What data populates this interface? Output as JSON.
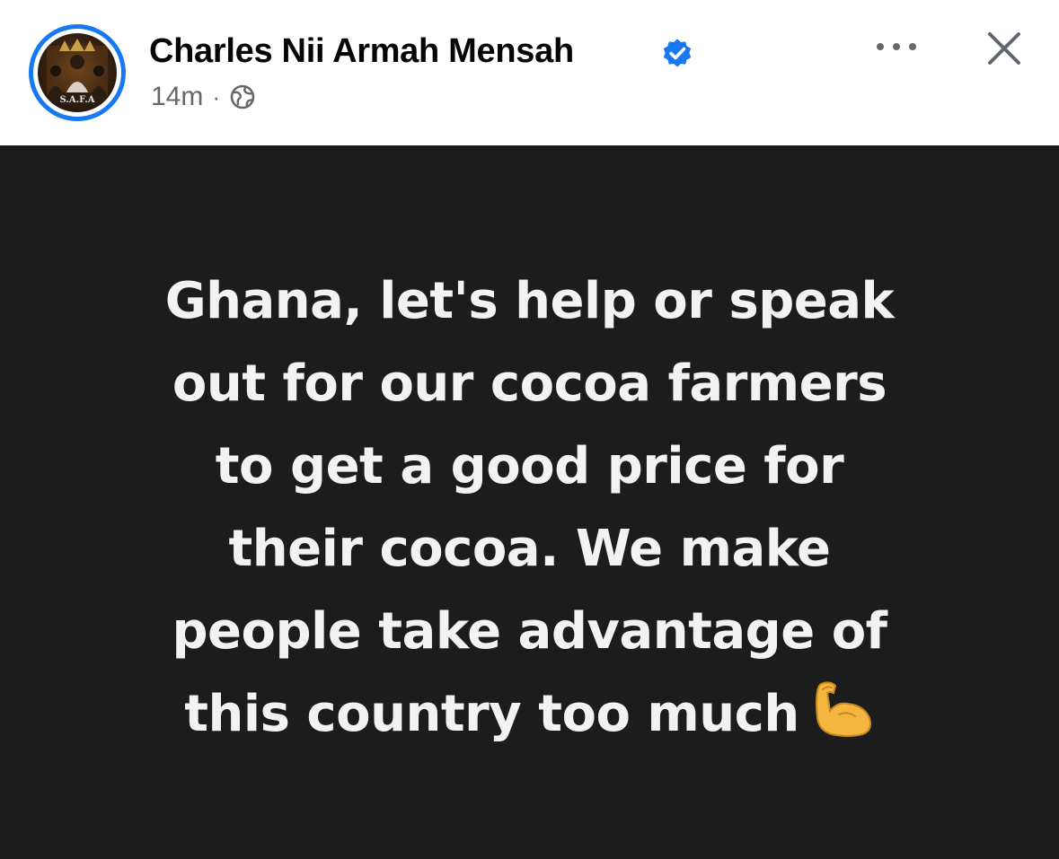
{
  "post": {
    "author": {
      "name": "Charles Nii Armah Mensah",
      "verified_icon": "verified-badge-icon",
      "avatar_label": "S.A.F.A"
    },
    "meta": {
      "timestamp": "14m",
      "separator": "·",
      "audience_icon": "globe-icon"
    },
    "actions": {
      "more_icon": "more-horizontal-icon",
      "close_icon": "close-icon"
    },
    "text_lines": [
      "Ghana, let's help or speak",
      "out for our cocoa farmers",
      "to get a good price for",
      "their cocoa. We make",
      "people take advantage of",
      "this country too much"
    ],
    "emoji_icon": "flexed-biceps-icon",
    "colors": {
      "background_card": "#1c1c1c",
      "text": "#f2f2f2",
      "accent_blue": "#1877f2",
      "meta_gray": "#65676b"
    }
  }
}
